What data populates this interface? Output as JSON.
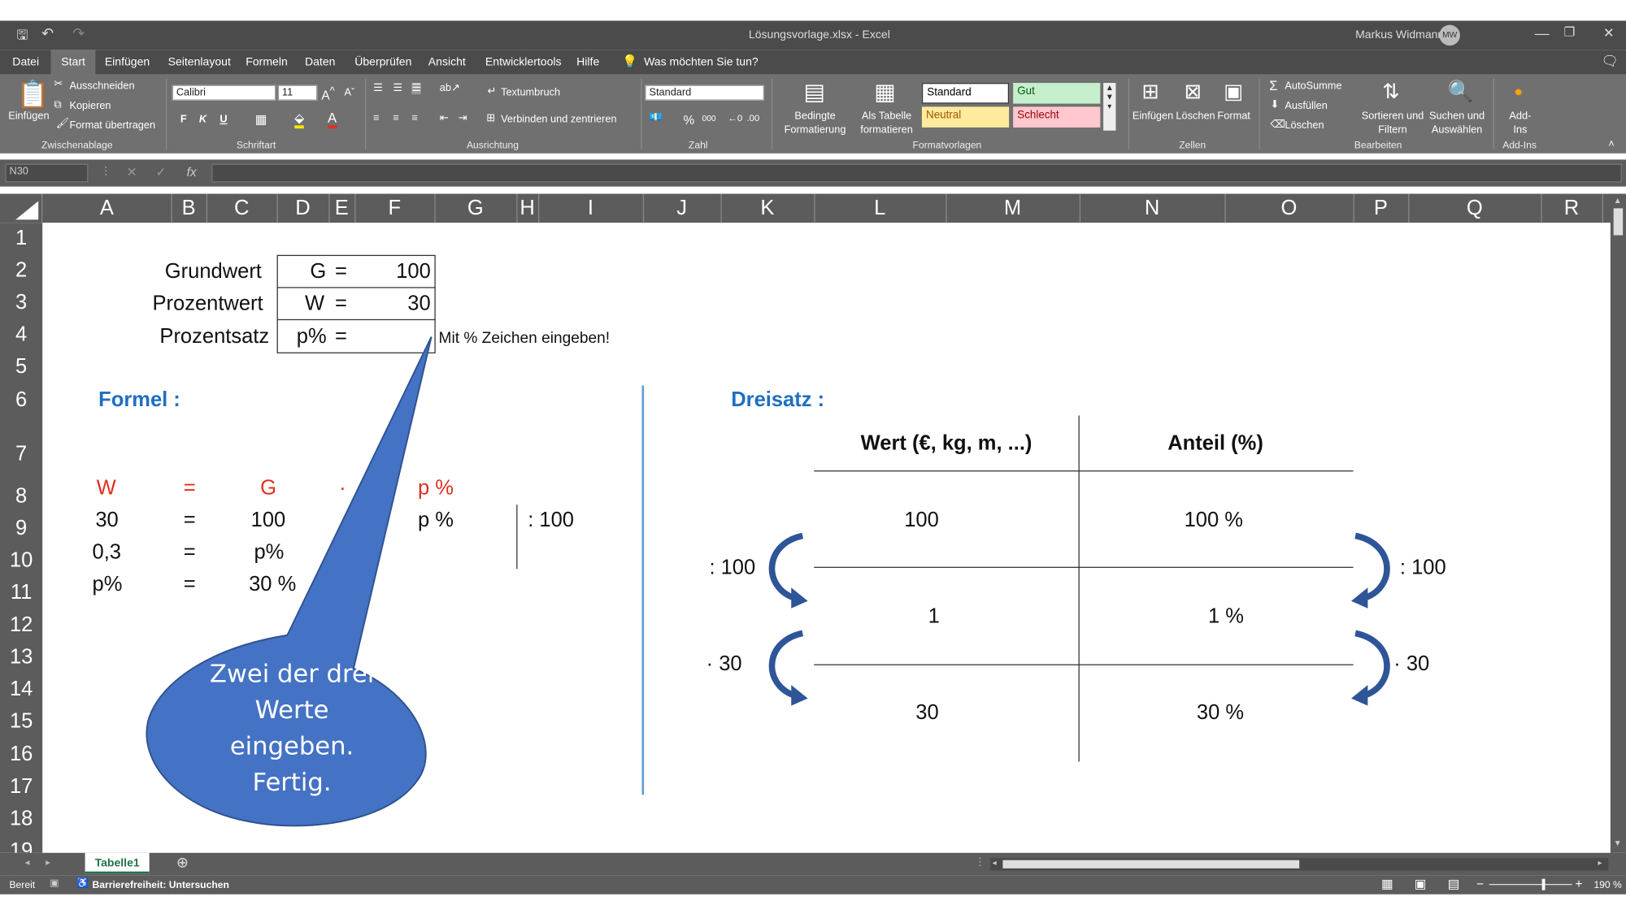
{
  "window": {
    "file_title": "Lösungsvorlage.xlsx  -  Excel",
    "user": "Markus Widmann",
    "user_initials": "MW"
  },
  "menu": {
    "tabs": [
      "Datei",
      "Start",
      "Einfügen",
      "Seitenlayout",
      "Formeln",
      "Daten",
      "Überprüfen",
      "Ansicht",
      "Entwicklertools",
      "Hilfe"
    ],
    "active": "Start",
    "tell_me": "Was möchten Sie tun?"
  },
  "ribbon": {
    "clipboard": {
      "paste": "Einfügen",
      "cut": "Ausschneiden",
      "copy": "Kopieren",
      "format_painter": "Format übertragen",
      "group": "Zwischenablage"
    },
    "font": {
      "name": "Calibri",
      "size": "11",
      "bold": "F",
      "italic": "K",
      "underline": "U",
      "group": "Schriftart"
    },
    "alignment": {
      "wrap": "Textumbruch",
      "merge": "Verbinden und zentrieren",
      "group": "Ausrichtung"
    },
    "number": {
      "format": "Standard",
      "percent": "%",
      "thousands": "000",
      "group": "Zahl"
    },
    "styles": {
      "conditional": "Bedingte Formatierung",
      "as_table": "Als Tabelle formatieren",
      "standard": "Standard",
      "gut": "Gut",
      "neutral": "Neutral",
      "schlecht": "Schlecht",
      "group": "Formatvorlagen"
    },
    "cells": {
      "insert": "Einfügen",
      "delete": "Löschen",
      "format": "Format",
      "group": "Zellen"
    },
    "editing": {
      "autosum": "AutoSumme",
      "fill": "Ausfüllen",
      "clear": "Löschen",
      "sort": "Sortieren und Filtern",
      "find": "Suchen und Auswählen",
      "group": "Bearbeiten"
    },
    "addins": {
      "label": "Add-Ins",
      "group": "Add-Ins"
    }
  },
  "formula_bar": {
    "name_box": "N30",
    "fx": "fx",
    "cancel": "✕",
    "enter": "✓",
    "value": ""
  },
  "columns": [
    "A",
    "B",
    "C",
    "D",
    "E",
    "F",
    "G",
    "H",
    "I",
    "J",
    "K",
    "L",
    "M",
    "N",
    "O",
    "P",
    "Q",
    "R"
  ],
  "rows": [
    "1",
    "2",
    "3",
    "4",
    "5",
    "6",
    "7",
    "8",
    "9",
    "10",
    "11",
    "12",
    "13",
    "14",
    "15",
    "16",
    "17",
    "18",
    "19"
  ],
  "sheet": {
    "labels": {
      "grundwert": "Grundwert",
      "prozentwert": "Prozentwert",
      "prozentsatz": "Prozentsatz"
    },
    "table": {
      "g_sym": "G",
      "w_sym": "W",
      "p_sym": "p%",
      "eq": "=",
      "g_val": "100",
      "w_val": "30",
      "p_val": ""
    },
    "hint": "Mit % Zeichen eingeben!",
    "formel_title": "Formel :",
    "formula_rows": [
      {
        "a": "W",
        "eq": "=",
        "c": "G",
        "dot": "·",
        "g": "p %"
      },
      {
        "a": "30",
        "eq": "=",
        "c": "100",
        "g": "p %",
        "op": ": 100"
      },
      {
        "a": "0,3",
        "eq": "=",
        "c": "p%"
      },
      {
        "a": "p%",
        "eq": "=",
        "c": "30 %"
      }
    ],
    "callout": "Zwei der drei Werte eingeben. Fertig.",
    "dreisatz_title": "Dreisatz :",
    "dreisatz": {
      "h1": "Wert (€, kg, m, ...)",
      "h2": "Anteil (%)",
      "r1": [
        "100",
        "100 %"
      ],
      "r2": [
        "1",
        "1 %"
      ],
      "r3": [
        "30",
        "30 %"
      ],
      "ops": [
        ": 100",
        ": 100",
        "· 30",
        "· 30"
      ]
    }
  },
  "sheet_tab": "Tabelle1",
  "status": {
    "ready": "Bereit",
    "accessibility": "Barrierefreiheit: Untersuchen",
    "zoom": "190 %"
  },
  "colors": {
    "blue_heading": "#1f6fc0",
    "red": "#e0301e",
    "callout": "#4472c4",
    "tab_green": "#217346"
  }
}
